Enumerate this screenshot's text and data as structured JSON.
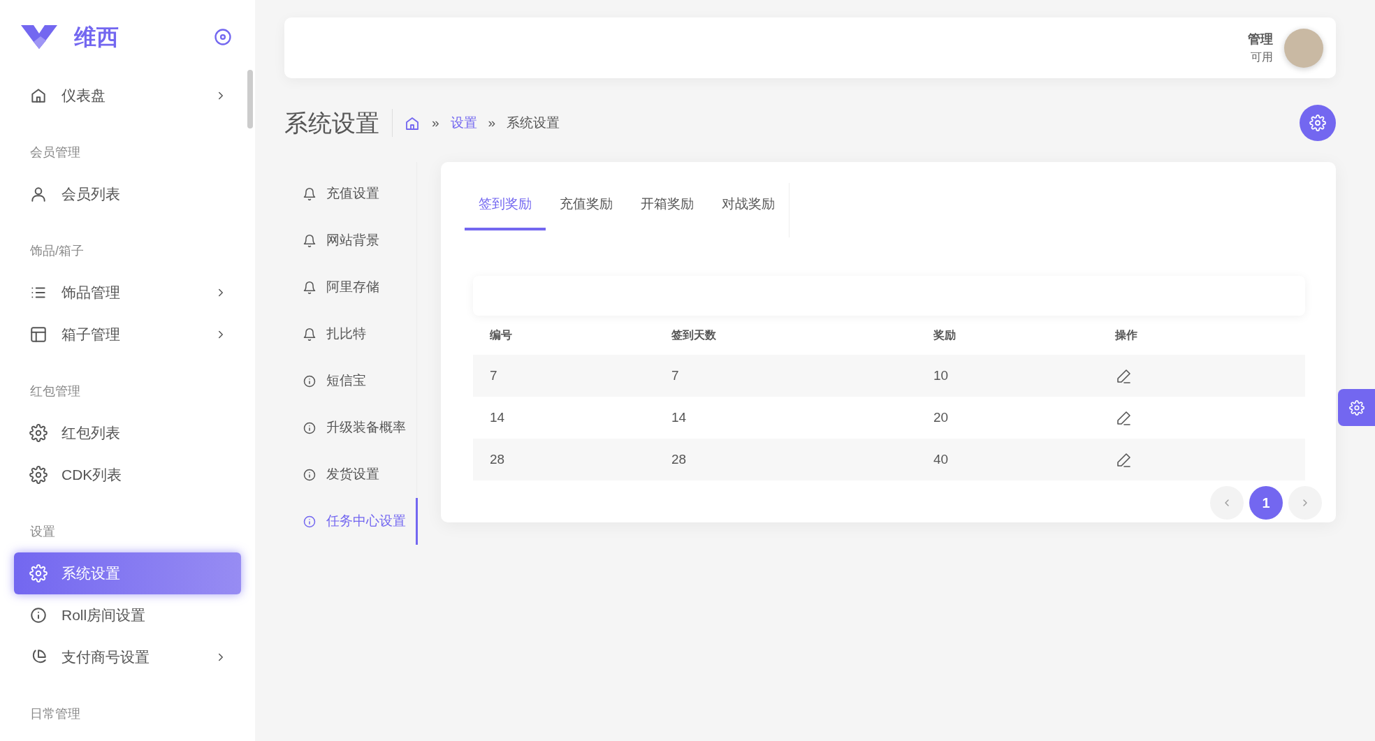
{
  "sidebar": {
    "brand": "维西",
    "sections": [
      {
        "items": [
          {
            "label": "仪表盘",
            "expandable": true,
            "selected": false
          }
        ]
      },
      {
        "heading": "会员管理",
        "items": [
          {
            "label": "会员列表",
            "expandable": false,
            "selected": false
          }
        ]
      },
      {
        "heading": "饰品/箱子",
        "items": [
          {
            "label": "饰品管理",
            "expandable": true,
            "selected": false
          },
          {
            "label": "箱子管理",
            "expandable": true,
            "selected": false
          }
        ]
      },
      {
        "heading": "红包管理",
        "items": [
          {
            "label": "红包列表",
            "expandable": false,
            "selected": false
          },
          {
            "label": "CDK列表",
            "expandable": false,
            "selected": false
          }
        ]
      },
      {
        "heading": "设置",
        "items": [
          {
            "label": "系统设置",
            "expandable": false,
            "selected": true
          },
          {
            "label": "Roll房间设置",
            "expandable": false,
            "selected": false
          },
          {
            "label": "支付商号设置",
            "expandable": true,
            "selected": false
          }
        ]
      },
      {
        "heading": "日常管理"
      }
    ]
  },
  "header": {
    "user_name": "管理",
    "user_status": "可用"
  },
  "page": {
    "title": "系统设置",
    "breadcrumb": [
      {
        "separator": "»",
        "label": "设置"
      },
      {
        "separator": "»",
        "label": "系统设置"
      }
    ]
  },
  "settings_menu": [
    {
      "label": "充值设置",
      "selected": false
    },
    {
      "label": "网站背景",
      "selected": false
    },
    {
      "label": "阿里存储",
      "selected": false
    },
    {
      "label": "扎比特",
      "selected": false
    },
    {
      "label": "短信宝",
      "selected": false
    },
    {
      "label": "升级装备概率",
      "selected": false
    },
    {
      "label": "发货设置",
      "selected": false
    },
    {
      "label": "任务中心设置",
      "selected": true
    }
  ],
  "tabs": [
    {
      "label": "签到奖励",
      "selected": true
    },
    {
      "label": "充值奖励",
      "selected": false
    },
    {
      "label": "开箱奖励",
      "selected": false
    },
    {
      "label": "对战奖励",
      "selected": false
    }
  ],
  "table": {
    "columns": [
      "编号",
      "签到天数",
      "奖励",
      "操作"
    ],
    "rows": [
      [
        "7",
        "7",
        "10"
      ],
      [
        "14",
        "14",
        "20"
      ],
      [
        "28",
        "28",
        "40"
      ]
    ]
  },
  "pagination": {
    "pages": [
      {
        "label": "1",
        "selected": true
      }
    ]
  }
}
